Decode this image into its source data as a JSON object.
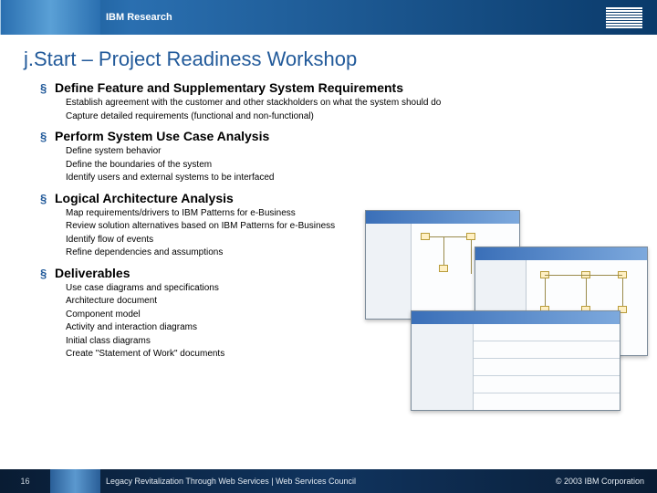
{
  "header": {
    "label": "IBM Research",
    "logo_name": "ibm-logo"
  },
  "title": "j.Start – Project Readiness Workshop",
  "sections": [
    {
      "heading": "Define Feature and Supplementary System Requirements",
      "items": [
        "Establish agreement with the customer and other stackholders on what the system should do",
        "Capture detailed requirements (functional and non-functional)"
      ]
    },
    {
      "heading": "Perform System Use Case Analysis",
      "items": [
        "Define system behavior",
        "Define the boundaries of  the system",
        "Identify users and external systems to be interfaced"
      ]
    },
    {
      "heading": "Logical Architecture Analysis",
      "items": [
        "Map requirements/drivers to IBM Patterns for e-Business",
        "Review solution alternatives based on IBM Patterns for e-Business",
        "Identify flow of events",
        "Refine dependencies and assumptions"
      ]
    },
    {
      "heading": "Deliverables",
      "items": [
        "Use case diagrams and specifications",
        "Architecture document",
        "Component model",
        "Activity and interaction diagrams",
        "Initial class diagrams",
        "Create \"Statement of Work\" documents"
      ]
    }
  ],
  "footer": {
    "page": "16",
    "text": "Legacy Revitalization Through Web Services   |  Web Services Council",
    "copyright": "© 2003 IBM Corporation"
  }
}
